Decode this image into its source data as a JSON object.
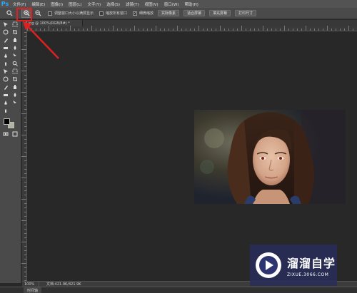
{
  "app": {
    "logo": "Ps"
  },
  "menu": [
    "文件(F)",
    "编辑(E)",
    "图像(I)",
    "图层(L)",
    "文字(Y)",
    "选择(S)",
    "滤镜(T)",
    "视图(V)",
    "窗口(W)",
    "帮助(H)"
  ],
  "options_bar": {
    "checkbox_resize_label": "调整窗口大小以满屏显示",
    "checkbox_zoom_all_label": "缩放所有窗口",
    "checkbox_scrubby_label": "细微缩放",
    "scrubby_checked": true,
    "btn_actual_pixels": "实际像素",
    "btn_fit_screen": "适合屏幕",
    "btn_fill_screen": "填充屏幕",
    "btn_print_size": "打印尺寸"
  },
  "document": {
    "tab_title": "4.jpg @ 100%(RGB/8#) *"
  },
  "status": {
    "zoom": "100%",
    "doc_size": "文档:421.9K/421.9K"
  },
  "timeline": {
    "tab_label": "时间轴"
  },
  "watermark": {
    "title": "溜溜自学",
    "url": "ZIXUE.3066.COM"
  },
  "colors": {
    "highlight": "#e02020",
    "accent": "#31a8ff",
    "background_swatch": "#b9b1a2"
  }
}
